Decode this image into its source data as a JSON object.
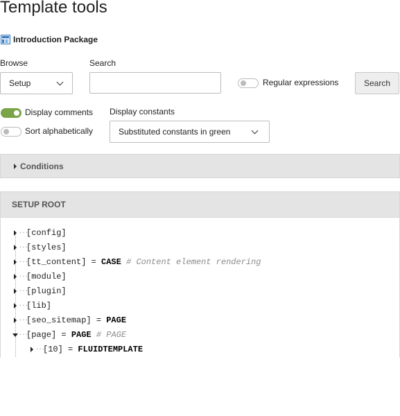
{
  "page": {
    "title": "Template tools"
  },
  "package": {
    "name": "Introduction Package",
    "icon": "template-icon"
  },
  "browse": {
    "label": "Browse",
    "value": "Setup"
  },
  "search": {
    "label": "Search",
    "value": "",
    "placeholder": "",
    "button": "Search"
  },
  "regex": {
    "label": "Regular expressions",
    "on": false
  },
  "display_comments": {
    "label": "Display comments",
    "on": true
  },
  "sort_alpha": {
    "label": "Sort alphabetically",
    "on": false
  },
  "display_constants": {
    "label": "Display constants",
    "value": "Substituted constants in green"
  },
  "conditions": {
    "label": "Conditions"
  },
  "setup": {
    "title": "SETUP ROOT",
    "rows": [
      {
        "key": "[config]",
        "op": "",
        "value": "",
        "comment": ""
      },
      {
        "key": "[styles]",
        "op": "",
        "value": "",
        "comment": ""
      },
      {
        "key": "[tt_content]",
        "op": " = ",
        "value": "CASE",
        "comment": " # Content element rendering"
      },
      {
        "key": "[module]",
        "op": "",
        "value": "",
        "comment": ""
      },
      {
        "key": "[plugin]",
        "op": "",
        "value": "",
        "comment": ""
      },
      {
        "key": "[lib]",
        "op": "",
        "value": "",
        "comment": ""
      },
      {
        "key": "[seo_sitemap]",
        "op": " = ",
        "value": "PAGE",
        "comment": ""
      },
      {
        "key": "[page]",
        "op": " = ",
        "value": "PAGE",
        "comment": " # PAGE"
      },
      {
        "key": "[10]",
        "op": " = ",
        "value": "FLUIDTEMPLATE",
        "comment": ""
      }
    ]
  },
  "colors": {
    "accent_green": "#79a548",
    "panel_header": "#e4e4e4"
  }
}
